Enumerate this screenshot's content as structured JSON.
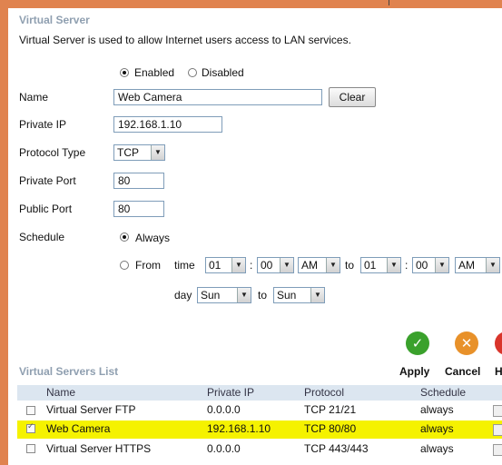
{
  "section": {
    "title": "Virtual Server",
    "description": "Virtual Server is used to allow Internet users access to LAN services."
  },
  "status": {
    "enabled_label": "Enabled",
    "disabled_label": "Disabled",
    "selected": "enabled"
  },
  "form": {
    "name_label": "Name",
    "name_value": "Web Camera",
    "clear_label": "Clear",
    "private_ip_label": "Private IP",
    "private_ip_value": "192.168.1.10",
    "protocol_label": "Protocol Type",
    "protocol_value": "TCP",
    "private_port_label": "Private Port",
    "private_port_value": "80",
    "public_port_label": "Public Port",
    "public_port_value": "80",
    "schedule_label": "Schedule",
    "always_label": "Always",
    "from_label": "From",
    "time_label": "time",
    "from_hour": "01",
    "from_minute": "00",
    "from_ampm": "AM",
    "to_label": "to",
    "to_hour": "01",
    "to_minute": "00",
    "to_ampm": "AM",
    "colon": ":",
    "day_label": "day",
    "day_from": "Sun",
    "day_to": "Sun"
  },
  "actions": {
    "apply_label": "Apply",
    "cancel_label": "Cancel",
    "help_label": "H",
    "colors": {
      "apply": "#3aa12c",
      "cancel": "#e8912a",
      "help": "#d9352b"
    }
  },
  "list": {
    "title": "Virtual Servers List",
    "headers": [
      "Name",
      "Private IP",
      "Protocol",
      "Schedule"
    ],
    "rows": [
      {
        "name": "Virtual Server FTP",
        "ip": "0.0.0.0",
        "protocol": "TCP 21/21",
        "schedule": "always",
        "checked": false
      },
      {
        "name": "Web Camera",
        "ip": "192.168.1.10",
        "protocol": "TCP 80/80",
        "schedule": "always",
        "checked": true
      },
      {
        "name": "Virtual Server HTTPS",
        "ip": "0.0.0.0",
        "protocol": "TCP 443/443",
        "schedule": "always",
        "checked": false
      }
    ]
  },
  "colors": {
    "frame": "#e0834f",
    "title": "#8f9fb0",
    "header_bg": "#dce6f0",
    "highlight": "#f5f200"
  }
}
